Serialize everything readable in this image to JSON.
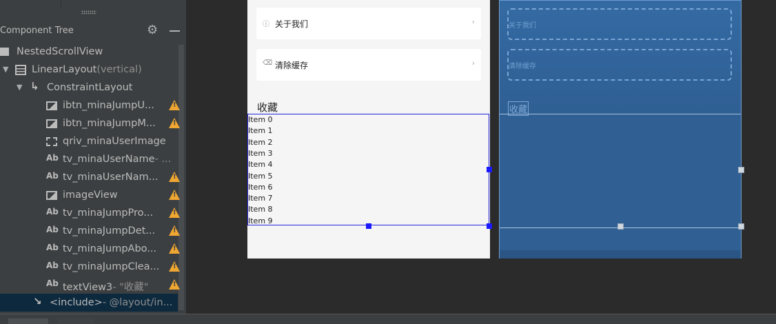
{
  "component_tree": {
    "title": "Component Tree",
    "rows": [
      {
        "label": "NestedScrollView",
        "secondary": "",
        "icon": "scrollview-icon",
        "warning": false
      },
      {
        "label": "LinearLayout",
        "secondary": "(vertical)",
        "icon": "linearlayout-icon",
        "warning": false
      },
      {
        "label": "ConstraintLayout",
        "secondary": "",
        "icon": "constraintlayout-icon",
        "warning": false
      },
      {
        "label": "ibtn_minaJumpU...",
        "secondary": "",
        "icon": "image-icon",
        "warning": true
      },
      {
        "label": "ibtn_minaJumpM...",
        "secondary": "",
        "icon": "image-icon",
        "warning": true
      },
      {
        "label": "qriv_minaUserImage",
        "secondary": "",
        "icon": "unknown-view-icon",
        "warning": false
      },
      {
        "label": "tv_minaUserName",
        "secondary": "- ...",
        "icon": "text-icon",
        "warning": false
      },
      {
        "label": "tv_minaUserNam...",
        "secondary": "",
        "icon": "text-icon",
        "warning": true
      },
      {
        "label": "imageView",
        "secondary": "",
        "icon": "image-icon",
        "warning": true
      },
      {
        "label": "tv_minaJumpPro...",
        "secondary": "",
        "icon": "text-icon",
        "warning": true
      },
      {
        "label": "tv_minaJumpDet...",
        "secondary": "",
        "icon": "text-icon",
        "warning": true
      },
      {
        "label": "tv_minaJumpAbo...",
        "secondary": "",
        "icon": "text-icon",
        "warning": true
      },
      {
        "label": "tv_minaJumpClea...",
        "secondary": "",
        "icon": "text-icon",
        "warning": true
      },
      {
        "label": "textView3",
        "secondary": "- \"收藏\"",
        "icon": "text-icon",
        "warning": true
      },
      {
        "label": "<include>",
        "secondary": "- @layout/in...",
        "icon": "include-icon",
        "warning": false
      }
    ]
  },
  "design": {
    "cards": [
      {
        "icon": "info-icon",
        "label": "关于我们",
        "arrow": "›"
      },
      {
        "icon": "clean-icon",
        "label": "清除缓存",
        "arrow": "›"
      }
    ],
    "favorites_title": "收藏",
    "list_items": [
      "Item 0",
      "Item 1",
      "Item 2",
      "Item 3",
      "Item 4",
      "Item 5",
      "Item 6",
      "Item 7",
      "Item 8",
      "Item 9"
    ]
  },
  "blueprint": {
    "cards": [
      "关于我们",
      "清除缓存"
    ],
    "favorites_title": "收藏"
  },
  "colors": {
    "panel_bg": "#3c3f41",
    "canvas_bg": "#2b2b2b",
    "blueprint_bg": "#2f5f93",
    "warning": "#f0a732",
    "selection": "#0d293e"
  }
}
